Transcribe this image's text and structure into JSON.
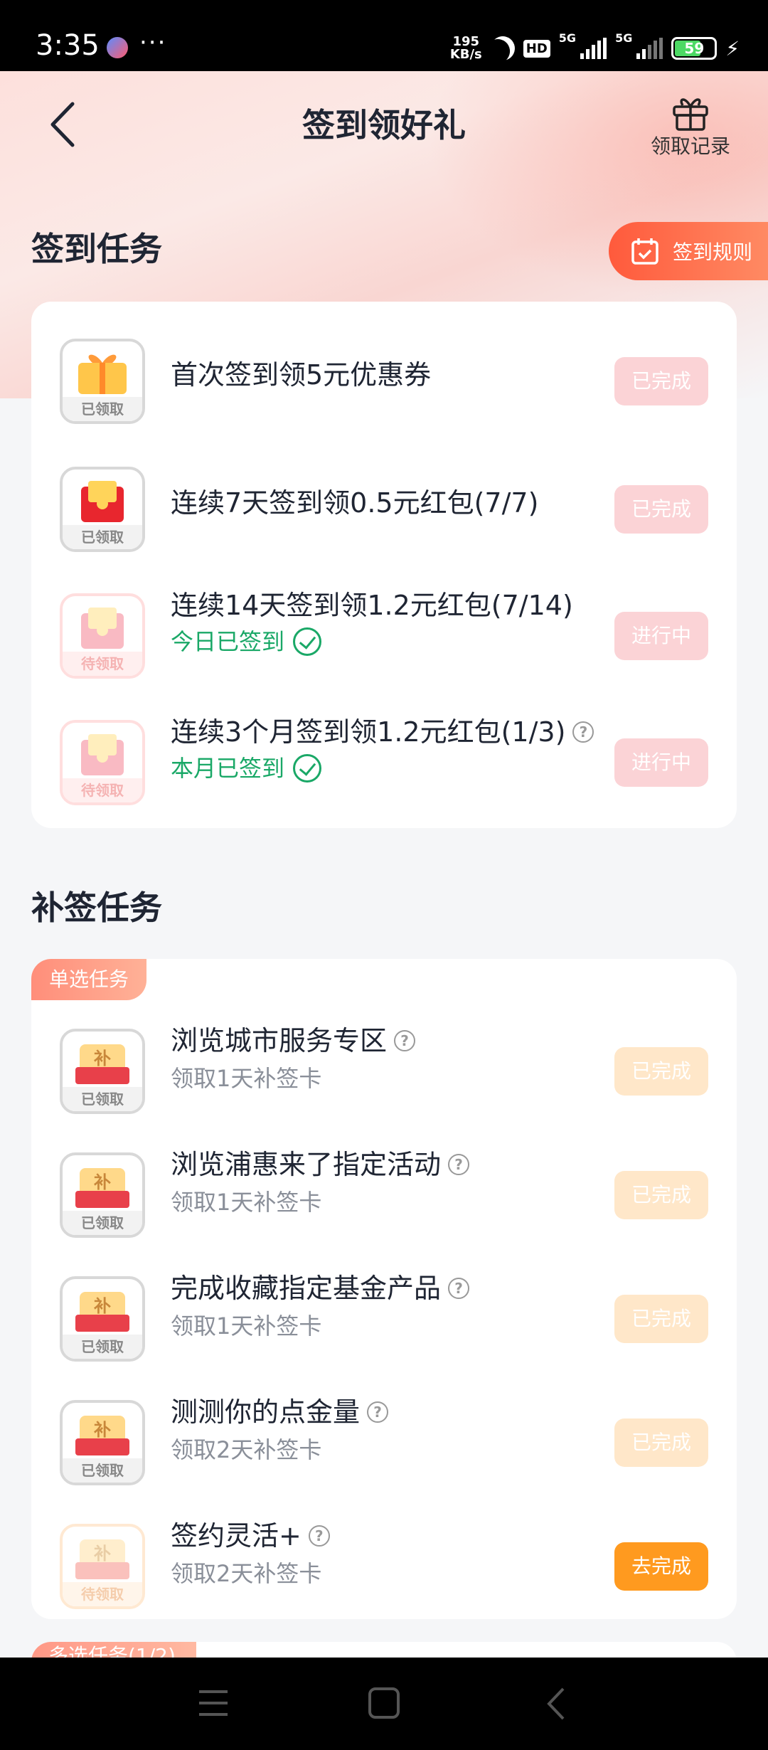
{
  "status_bar": {
    "time": "3:35",
    "speed_value": "195",
    "speed_unit": "KB/s",
    "hd_label": "HD",
    "net1": "5G",
    "net2": "5G",
    "battery": "59"
  },
  "header": {
    "title": "签到领好礼",
    "record_label": "领取记录",
    "rules_label": "签到规则"
  },
  "checkin_section": {
    "title": "签到任务",
    "tasks": [
      {
        "title": "首次签到领5元优惠券",
        "tag": "已领取",
        "status": "已完成",
        "sub": ""
      },
      {
        "title": "连续7天签到领0.5元红包(7/7)",
        "tag": "已领取",
        "status": "已完成",
        "sub": ""
      },
      {
        "title": "连续14天签到领1.2元红包(7/14)",
        "tag": "待领取",
        "status": "进行中",
        "sub": "今日已签到"
      },
      {
        "title": "连续3个月签到领1.2元红包(1/3)",
        "tag": "待领取",
        "status": "进行中",
        "sub": "本月已签到"
      }
    ]
  },
  "makeup_section": {
    "title": "补签任务",
    "ribbon": "单选任务",
    "tasks": [
      {
        "title": "浏览城市服务专区",
        "sub": "领取1天补签卡",
        "tag": "已领取",
        "status": "已完成"
      },
      {
        "title": "浏览浦惠来了指定活动",
        "sub": "领取1天补签卡",
        "tag": "已领取",
        "status": "已完成"
      },
      {
        "title": "完成收藏指定基金产品",
        "sub": "领取1天补签卡",
        "tag": "已领取",
        "status": "已完成"
      },
      {
        "title": "测测你的点金量",
        "sub": "领取2天补签卡",
        "tag": "已领取",
        "status": "已完成"
      },
      {
        "title": "签约灵活+",
        "sub": "领取2天补签卡",
        "tag": "待领取",
        "status": "去完成"
      }
    ],
    "next_ribbon": "多选任务(1/2)"
  },
  "help_glyph": "?",
  "badge_char": "补",
  "colors": {
    "accent_orange": "#ff9a1f",
    "rules_red": "#ff5a3c",
    "done_pink": "#fbd3d6",
    "done_peach": "#ffe7c9",
    "signed_green": "#1aa867"
  }
}
